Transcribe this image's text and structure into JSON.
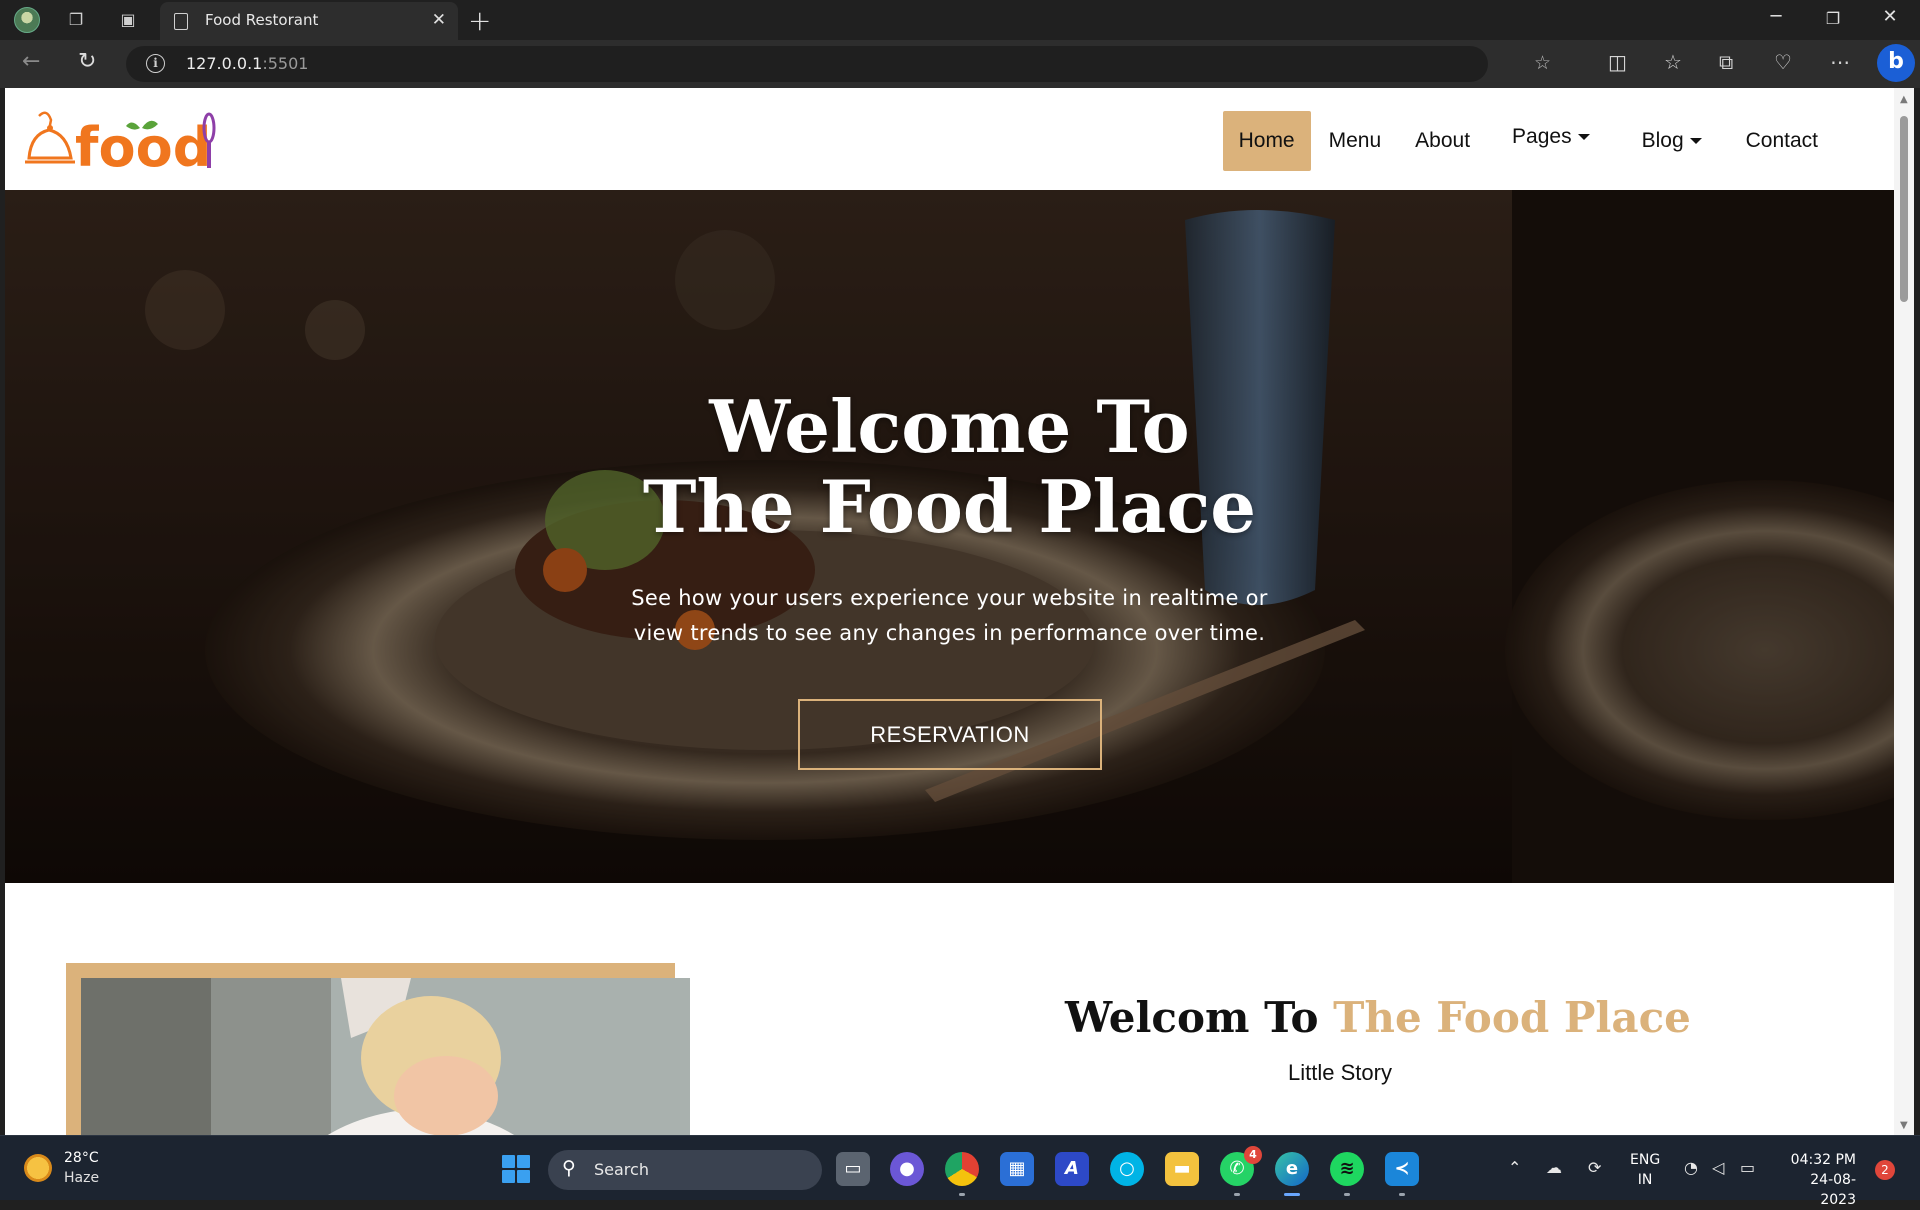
{
  "browser": {
    "tab_title": "Food Restorant",
    "url_host": "127.0.0.1",
    "url_port": ":5501"
  },
  "site": {
    "nav": [
      {
        "label": "Home",
        "active": true
      },
      {
        "label": "Menu"
      },
      {
        "label": "About"
      },
      {
        "label": "Pages",
        "dropdown": true
      },
      {
        "label": "Blog",
        "dropdown": true
      },
      {
        "label": "Contact"
      }
    ],
    "hero": {
      "title_line1": "Welcome To",
      "title_line2": "The Food Place",
      "subtitle_line1": "See how your users experience your website in realtime or",
      "subtitle_line2": "view trends to see any changes in performance over time.",
      "button": "RESERVATION"
    },
    "about": {
      "heading_prefix": "Welcom To",
      "heading_accent": "The Food Place",
      "subheading": "Little Story"
    },
    "colors": {
      "accent": "#dbb27b",
      "logo_orange": "#f0761e",
      "logo_purple": "#8e3fa8"
    }
  },
  "taskbar": {
    "weather_temp": "28°C",
    "weather_cond": "Haze",
    "search_placeholder": "Search",
    "whatsapp_badge": "4",
    "lang_line1": "ENG",
    "lang_line2": "IN",
    "time": "04:32 PM",
    "date": "24-08-2023",
    "notification_count": "2"
  }
}
